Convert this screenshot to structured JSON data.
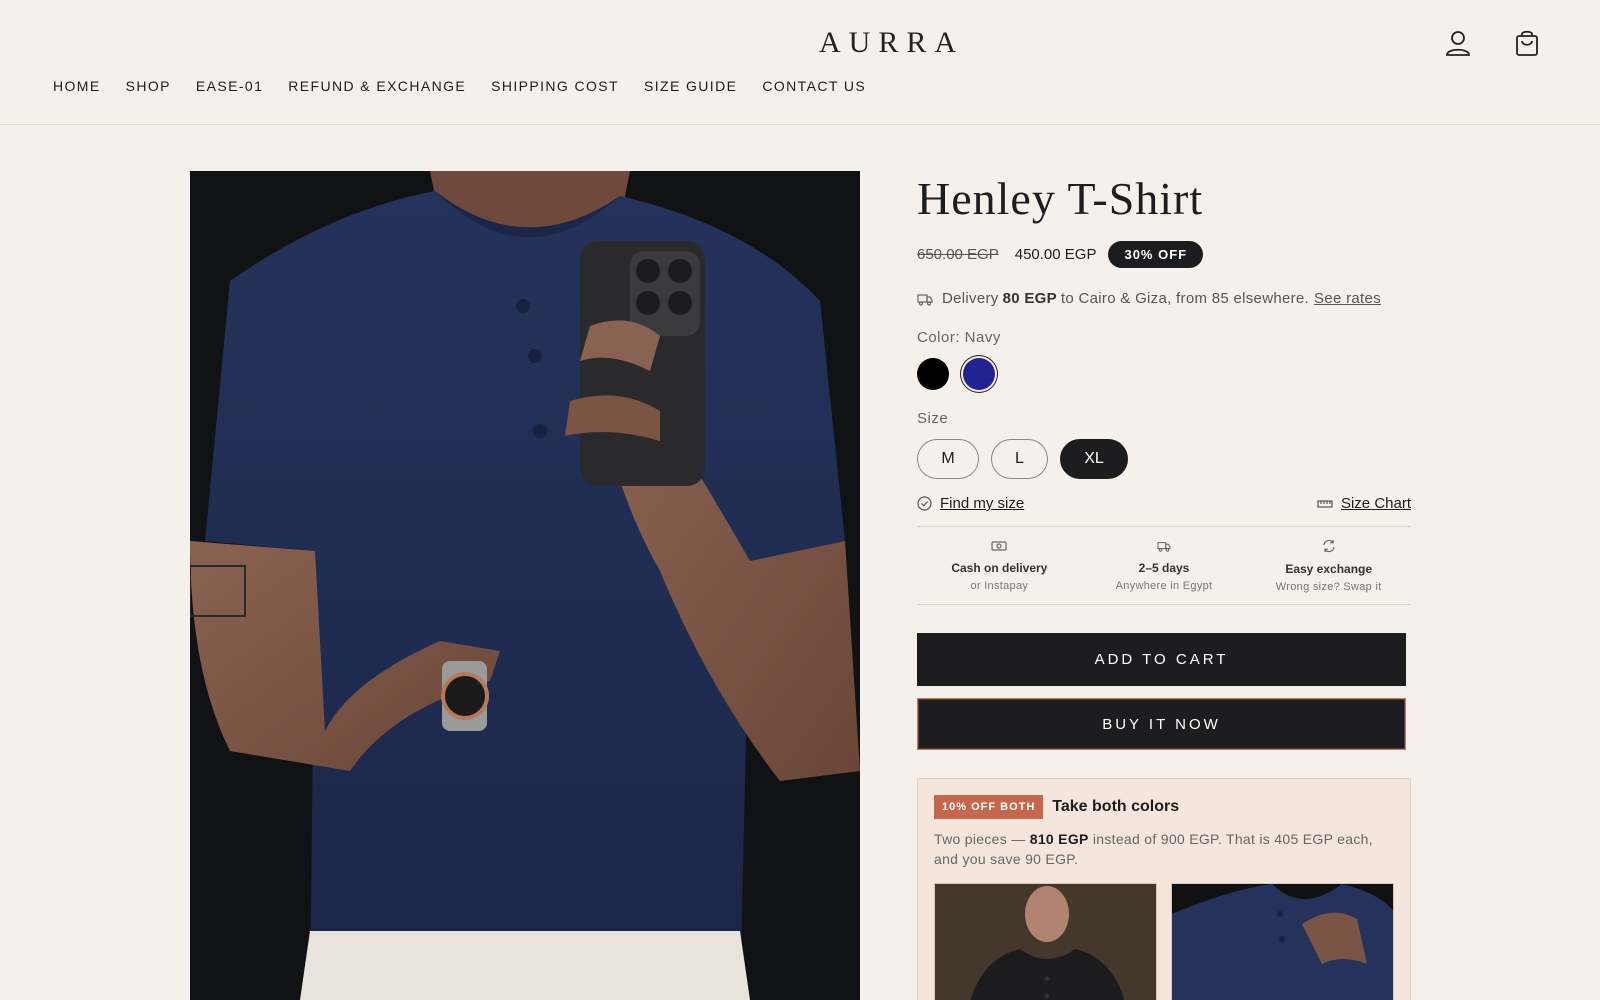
{
  "brand": {
    "logo": "AURRA"
  },
  "header": {
    "account_icon": "user-icon",
    "cart_icon": "shopping-bag-icon"
  },
  "nav": {
    "items": [
      "HOME",
      "SHOP",
      "EASE-01",
      "REFUND & EXCHANGE",
      "SHIPPING COST",
      "SIZE GUIDE",
      "CONTACT US"
    ]
  },
  "product": {
    "title": "Henley T-Shirt",
    "old_price": "650.00 EGP",
    "price": "450.00 EGP",
    "discount_badge": "30% OFF",
    "image_alt": "Man in navy henley t-shirt taking mirror selfie",
    "delivery": {
      "prefix": "Delivery",
      "amount": "80 EGP",
      "suffix": "to Cairo & Giza, from 85 elsewhere.",
      "link": "See rates"
    },
    "color": {
      "label": "Color: Navy",
      "options": [
        {
          "name": "Black",
          "hex": "#000000"
        },
        {
          "name": "Navy",
          "hex": "#232291",
          "selected": true
        }
      ]
    },
    "size": {
      "label": "Size",
      "options": [
        "M",
        "L",
        "XL"
      ],
      "selected": "XL"
    },
    "find_size_link": "Find my size",
    "size_chart_link": "Size Chart",
    "perks": [
      {
        "icon": "cash-icon",
        "title": "Cash on delivery",
        "subtitle": "or Instapay"
      },
      {
        "icon": "truck-icon",
        "title": "2–5 days",
        "subtitle": "Anywhere in Egypt"
      },
      {
        "icon": "refresh-icon",
        "title": "Easy exchange",
        "subtitle": "Wrong size? Swap it"
      }
    ],
    "add_to_cart": "ADD TO CART",
    "buy_now": "BUY IT NOW"
  },
  "bundle": {
    "badge": "10% OFF BOTH",
    "title": "Take both colors",
    "desc_prefix": "Two pieces —",
    "desc_price": "810 EGP",
    "desc_suffix": "instead of 900 EGP. That is 405 EGP each, and you save 90 EGP."
  },
  "colors": {
    "background": "#f5f1ea",
    "primary": "#1d1d1f",
    "accent": "#c4674c",
    "navy": "#232291"
  }
}
